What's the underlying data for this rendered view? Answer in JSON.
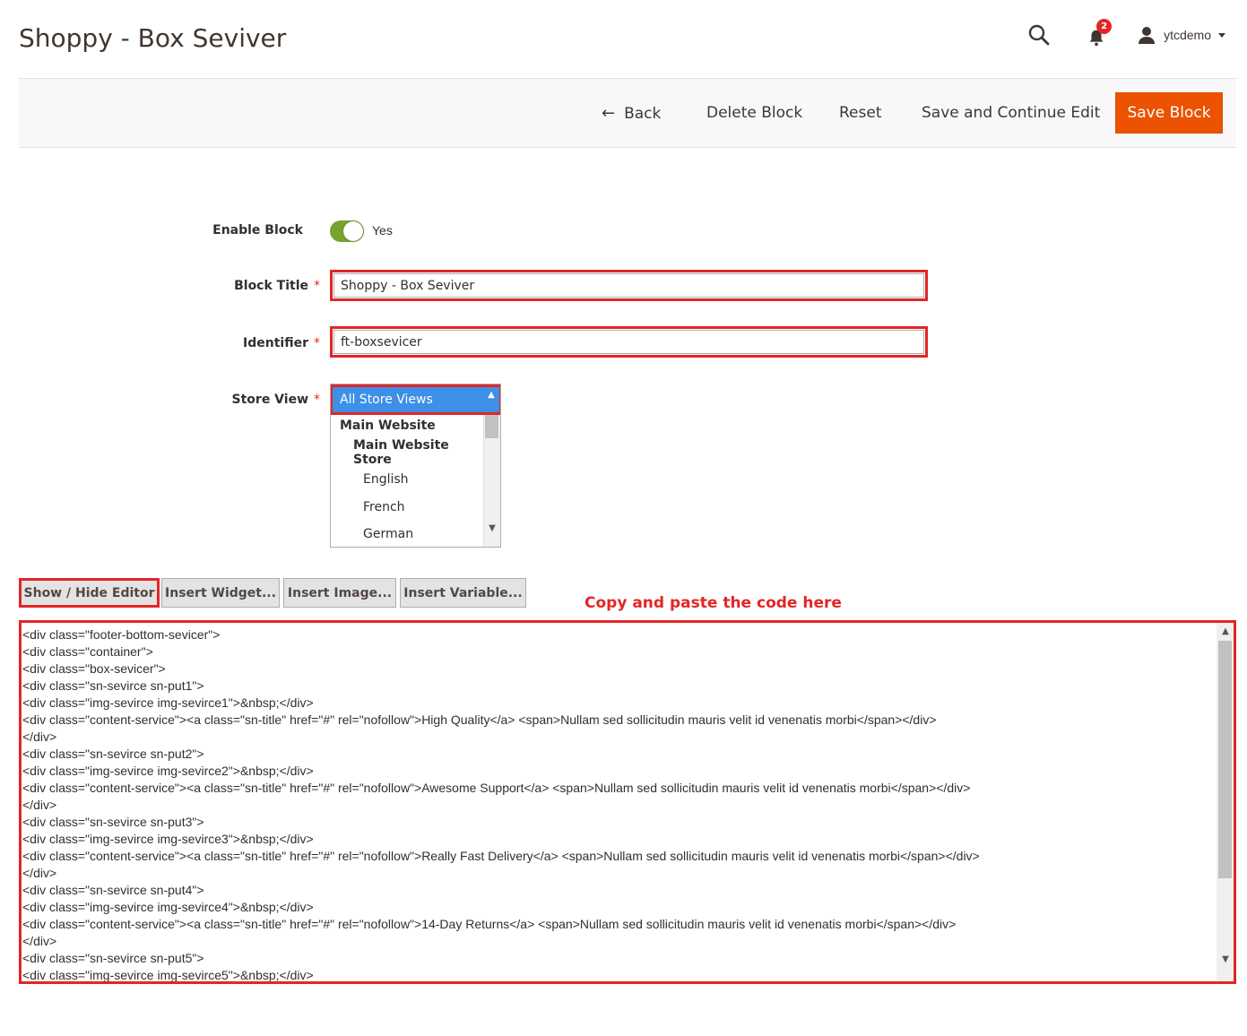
{
  "header": {
    "title": "Shoppy - Box Seviver",
    "notification_count": "2",
    "user_name": "ytcdemo"
  },
  "actions": {
    "back": "Back",
    "delete": "Delete Block",
    "reset": "Reset",
    "save_continue": "Save and Continue Edit",
    "save": "Save Block"
  },
  "form": {
    "enable_label": "Enable Block",
    "enable_value": "Yes",
    "title_label": "Block Title",
    "title_value": "Shoppy - Box Seviver",
    "identifier_label": "Identifier",
    "identifier_value": "ft-boxsevicer",
    "store_label": "Store View",
    "required_mark": "*",
    "store_options": [
      "All Store Views",
      "Main Website",
      "Main Website Store",
      "English",
      "French",
      "German"
    ]
  },
  "editor": {
    "show_hide": "Show / Hide Editor",
    "insert_widget": "Insert Widget...",
    "insert_image": "Insert Image...",
    "insert_variable": "Insert Variable...",
    "annotation": "Copy and paste the code here",
    "code_lines": [
      "<div class=\"footer-bottom-sevicer\">",
      "<div class=\"container\">",
      "<div class=\"box-sevicer\">",
      "<div class=\"sn-sevirce sn-put1\">",
      "<div class=\"img-sevirce img-sevirce1\">&nbsp;</div>",
      "<div class=\"content-service\"><a class=\"sn-title\" href=\"#\" rel=\"nofollow\">High Quality</a> <span>Nullam sed sollicitudin mauris velit id venenatis morbi</span></div>",
      "</div>",
      "<div class=\"sn-sevirce sn-put2\">",
      "<div class=\"img-sevirce img-sevirce2\">&nbsp;</div>",
      "<div class=\"content-service\"><a class=\"sn-title\" href=\"#\" rel=\"nofollow\">Awesome Support</a> <span>Nullam sed sollicitudin mauris velit id venenatis morbi</span></div>",
      "</div>",
      "<div class=\"sn-sevirce sn-put3\">",
      "<div class=\"img-sevirce img-sevirce3\">&nbsp;</div>",
      "<div class=\"content-service\"><a class=\"sn-title\" href=\"#\" rel=\"nofollow\">Really Fast Delivery</a> <span>Nullam sed sollicitudin mauris velit id venenatis morbi</span></div>",
      "</div>",
      "<div class=\"sn-sevirce sn-put4\">",
      "<div class=\"img-sevirce img-sevirce4\">&nbsp;</div>",
      "<div class=\"content-service\"><a class=\"sn-title\" href=\"#\" rel=\"nofollow\">14-Day Returns</a> <span>Nullam sed sollicitudin mauris velit id venenatis morbi</span></div>",
      "</div>",
      "<div class=\"sn-sevirce sn-put5\">",
      "<div class=\"img-sevirce img-sevirce5\">&nbsp;</div>"
    ]
  },
  "colors": {
    "accent": "#eb5202",
    "highlight": "#e22626",
    "toggle_on": "#79a22e",
    "selected_option": "#3d8fe8"
  }
}
